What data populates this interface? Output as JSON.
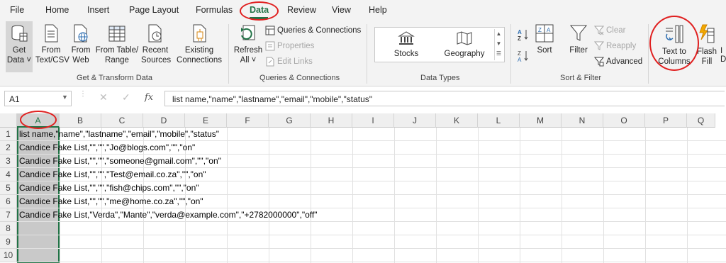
{
  "menu": {
    "tabs": [
      {
        "label": "File"
      },
      {
        "label": "Home"
      },
      {
        "label": "Insert"
      },
      {
        "label": "Page Layout"
      },
      {
        "label": "Formulas"
      },
      {
        "label": "Data"
      },
      {
        "label": "Review"
      },
      {
        "label": "View"
      },
      {
        "label": "Help"
      }
    ],
    "active": "Data"
  },
  "ribbon": {
    "get_transform": {
      "get_data": "Get\nData ˅",
      "from_text_csv": "From\nText/CSV",
      "from_web": "From\nWeb",
      "from_table_range": "From Table/\nRange",
      "recent_sources": "Recent\nSources",
      "existing_connections": "Existing\nConnections",
      "group_label": "Get & Transform Data"
    },
    "queries": {
      "refresh_all": "Refresh\nAll ˅",
      "queries_connections": "Queries & Connections",
      "properties": "Properties",
      "edit_links": "Edit Links",
      "group_label": "Queries & Connections"
    },
    "data_types": {
      "stocks": "Stocks",
      "geography": "Geography",
      "group_label": "Data Types"
    },
    "sort_filter": {
      "sort": "Sort",
      "filter": "Filter",
      "clear": "Clear",
      "reapply": "Reapply",
      "advanced": "Advanced",
      "group_label": "Sort & Filter"
    },
    "data_tools": {
      "text_to_columns": "Text to\nColumns",
      "flash_fill": "Flash\nFill"
    }
  },
  "formula_bar": {
    "name_box": "A1",
    "fx_label": "fx",
    "content": "list name,\"name\",\"lastname\",\"email\",\"mobile\",\"status\""
  },
  "grid": {
    "columns": [
      "A",
      "B",
      "C",
      "D",
      "E",
      "F",
      "G",
      "H",
      "I",
      "J",
      "K",
      "L",
      "M",
      "N",
      "O",
      "P",
      "Q"
    ],
    "selected_column": "A",
    "rows": [
      "1",
      "2",
      "3",
      "4",
      "5",
      "6",
      "7",
      "8",
      "9",
      "10"
    ],
    "cells": [
      "list name,\"name\",\"lastname\",\"email\",\"mobile\",\"status\"",
      "Candice Fake List,\"\",\"\",\"Jo@blogs.com\",\"\",\"on\"",
      "Candice Fake List,\"\",\"\",\"someone@gmail.com\",\"\",\"on\"",
      "Candice Fake List,\"\",\"\",\"Test@email.co.za\",\"\",\"on\"",
      "Candice Fake List,\"\",\"\",\"fish@chips.com\",\"\",\"on\"",
      "Candice Fake List,\"\",\"\",\"me@home.co.za\",\"\",\"on\"",
      "Candice Fake List,\"Verda\",\"Mante\",\"verda@example.com\",\"+2782000000\",\"off\""
    ]
  },
  "colors": {
    "accent": "#217346",
    "annotation": "#e02020"
  }
}
